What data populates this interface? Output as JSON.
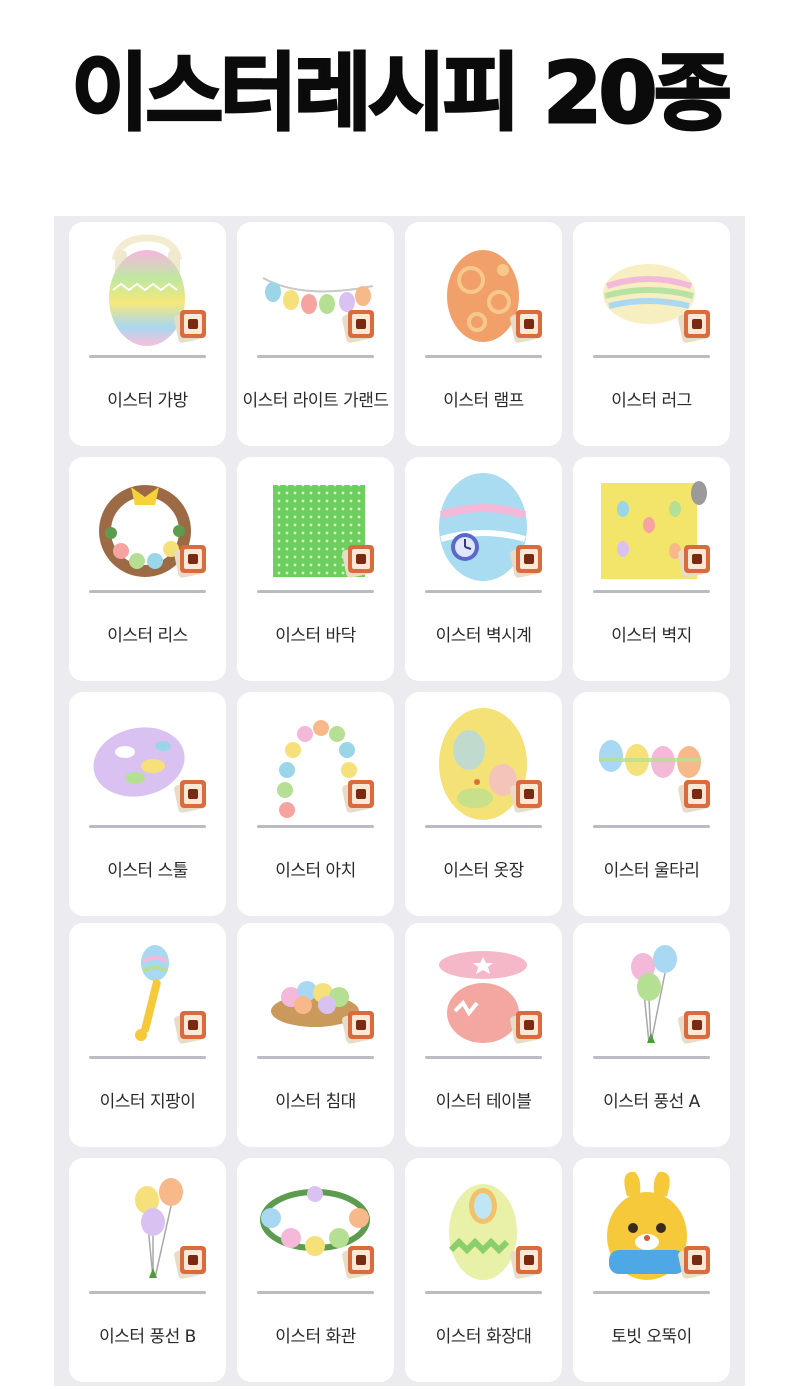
{
  "page": {
    "title": "이스터레시피 20종",
    "accent": "#0b0b0b",
    "panel_color": "#ececf0",
    "card_color": "#ffffff",
    "recipe_icon": "diy-recipe-card-icon"
  },
  "items": [
    {
      "label": "이스터 가방",
      "icon": "easter-bag-icon"
    },
    {
      "label": "이스터 라이트 가랜드",
      "icon": "easter-light-garland-icon"
    },
    {
      "label": "이스터 램프",
      "icon": "easter-lamp-icon"
    },
    {
      "label": "이스터 러그",
      "icon": "easter-rug-icon"
    },
    {
      "label": "이스터 리스",
      "icon": "easter-wreath-icon"
    },
    {
      "label": "이스터 바닥",
      "icon": "easter-flooring-icon"
    },
    {
      "label": "이스터 벽시계",
      "icon": "easter-wall-clock-icon"
    },
    {
      "label": "이스터 벽지",
      "icon": "easter-wallpaper-icon"
    },
    {
      "label": "이스터 스툴",
      "icon": "easter-stool-icon"
    },
    {
      "label": "이스터 아치",
      "icon": "easter-arch-icon"
    },
    {
      "label": "이스터 옷장",
      "icon": "easter-wardrobe-icon"
    },
    {
      "label": "이스터 울타리",
      "icon": "easter-fence-icon"
    },
    {
      "label": "이스터 지팡이",
      "icon": "easter-wand-icon"
    },
    {
      "label": "이스터 침대",
      "icon": "easter-bed-icon"
    },
    {
      "label": "이스터 테이블",
      "icon": "easter-table-icon"
    },
    {
      "label": "이스터 풍선 A",
      "icon": "easter-balloon-a-icon"
    },
    {
      "label": "이스터 풍선 B",
      "icon": "easter-balloon-b-icon"
    },
    {
      "label": "이스터 화관",
      "icon": "easter-flower-crown-icon"
    },
    {
      "label": "이스터 화장대",
      "icon": "easter-vanity-icon"
    },
    {
      "label": "토빗 오뚝이",
      "icon": "zipper-doll-icon"
    }
  ]
}
